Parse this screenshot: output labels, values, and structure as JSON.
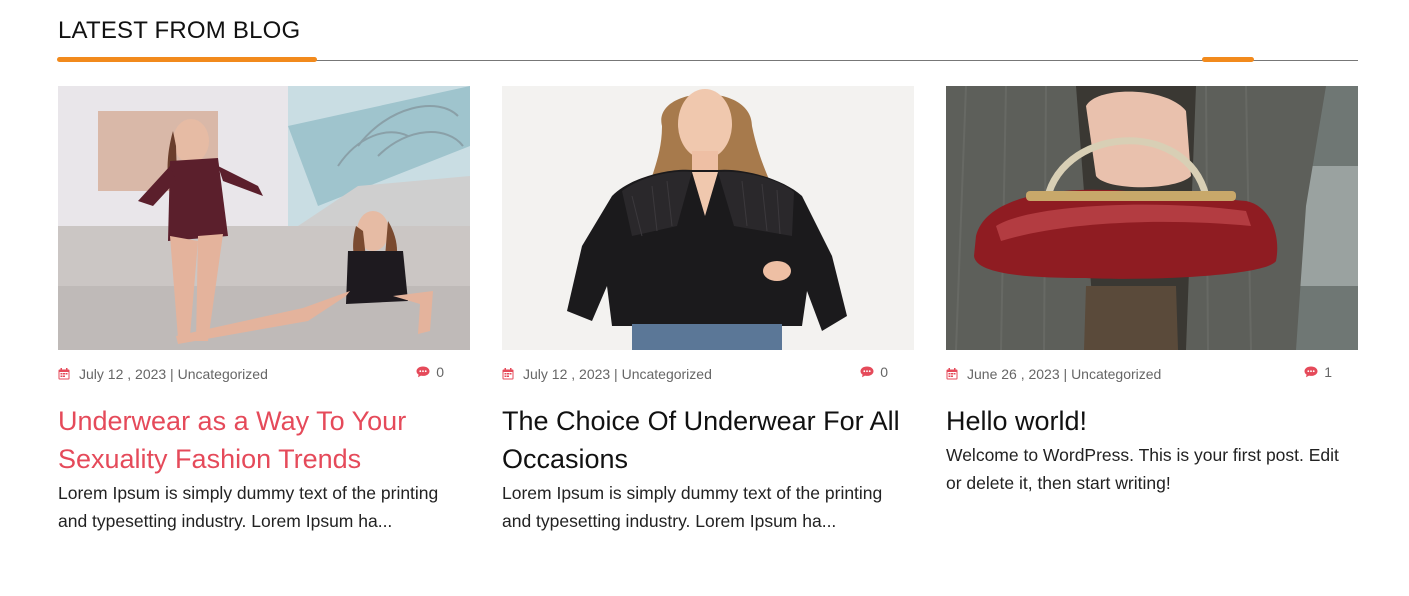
{
  "section": {
    "heading": "LATEST FROM BLOG",
    "accent_color": "#f28a1c",
    "link_hover_color": "#e54a5a"
  },
  "posts": [
    {
      "date": "July 12 , 2023",
      "category": "Uncategorized",
      "comments": "0",
      "title": "Underwear as a Way To Your Sexuality Fashion Trends",
      "excerpt": "Lorem Ipsum is simply dummy text of the printing and typesetting industry. Lorem Ipsum ha...",
      "image": "two women in bodysuits posing outdoors near stairs"
    },
    {
      "date": "July 12 , 2023",
      "category": "Uncategorized",
      "comments": "0",
      "title": "The Choice Of Underwear For All Occasions",
      "excerpt": "Lorem Ipsum is simply dummy text of the printing and typesetting industry. Lorem Ipsum ha...",
      "image": "woman in black lace blouse and jeans"
    },
    {
      "date": "June 26 , 2023",
      "category": "Uncategorized",
      "comments": "1",
      "title": "Hello world!",
      "excerpt": "Welcome to WordPress. This is your first post. Edit or delete it, then start writing!",
      "image": "hand holding a red patent leather handbag"
    }
  ],
  "icons": {
    "date": "calendar-icon",
    "comments": "comment-icon"
  }
}
